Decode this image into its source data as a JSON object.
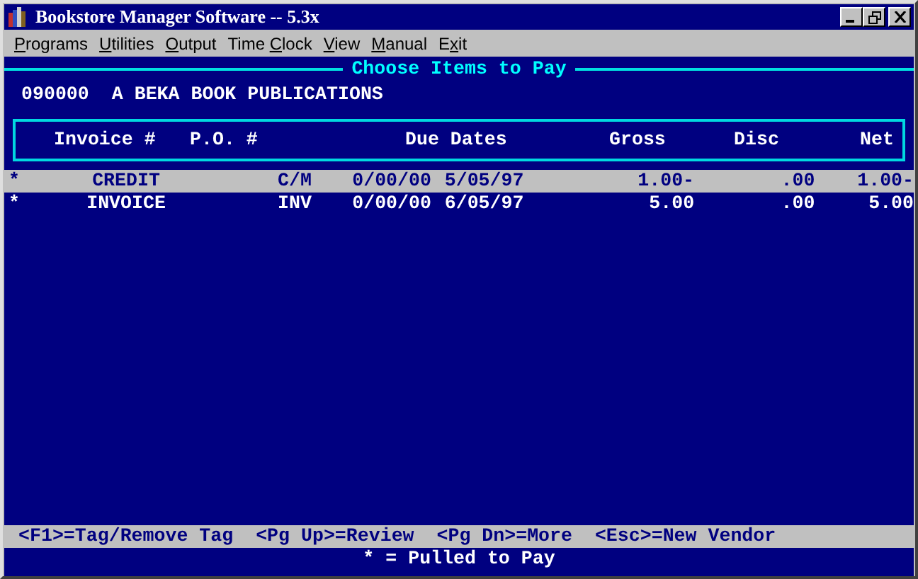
{
  "window": {
    "title": "Bookstore Manager Software -- 5.3x"
  },
  "menu": [
    {
      "key": "P",
      "post": "rograms"
    },
    {
      "key": "U",
      "post": "tilities"
    },
    {
      "key": "O",
      "post": "utput"
    },
    {
      "pre": "Time ",
      "key": "C",
      "post": "lock"
    },
    {
      "key": "V",
      "post": "iew"
    },
    {
      "key": "M",
      "post": "anual"
    },
    {
      "pre": "E",
      "key": "x",
      "post": "it"
    }
  ],
  "screen_title": "Choose Items to Pay",
  "vendor": {
    "code": "090000",
    "name": "A BEKA BOOK PUBLICATIONS"
  },
  "table": {
    "columns": [
      "Invoice #",
      "P.O. #",
      "Due Dates",
      "Gross",
      "Disc",
      "Net"
    ],
    "rows": [
      {
        "selected": true,
        "tag": "*",
        "invoice": "CREDIT",
        "type": "C/M",
        "date_1": "0/00/00",
        "date_2": "5/05/97",
        "gross": "1.00-",
        "disc": ".00",
        "net": "1.00-"
      },
      {
        "selected": false,
        "tag": "*",
        "invoice": "INVOICE",
        "type": "INV",
        "date_1": "0/00/00",
        "date_2": "6/05/97",
        "gross": "5.00",
        "disc": ".00",
        "net": "5.00"
      }
    ]
  },
  "key_help": "<F1>=Tag/Remove Tag  <Pg Up>=Review  <Pg Dn>=More  <Esc>=New Vendor",
  "legend": "* = Pulled to Pay"
}
